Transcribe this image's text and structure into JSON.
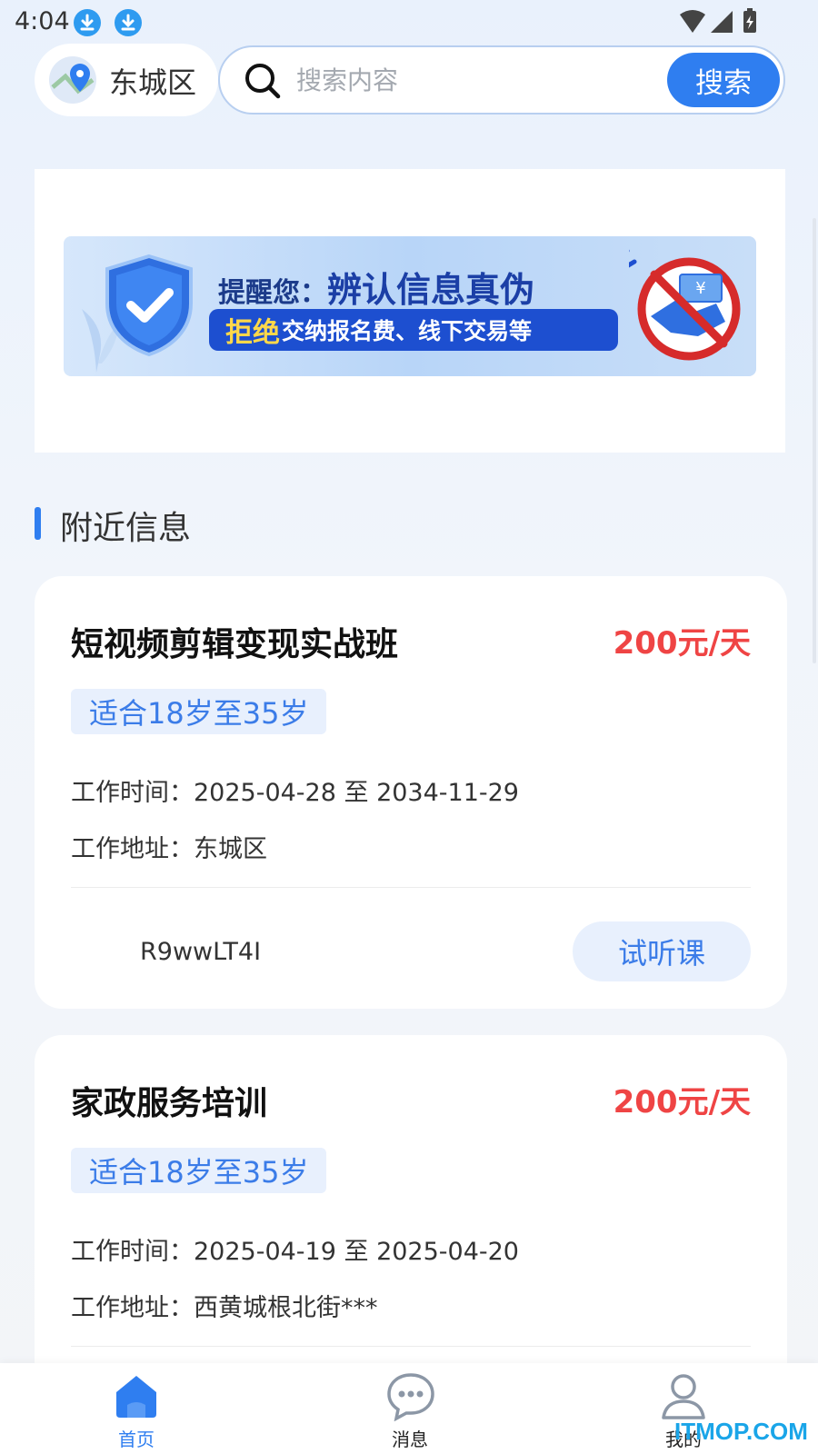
{
  "status_bar": {
    "time": "4:04"
  },
  "header": {
    "location": "东城区",
    "search_placeholder": "搜索内容",
    "search_button": "搜索"
  },
  "banner": {
    "prefix": "提醒您：",
    "headline": "辨认信息真伪",
    "highlight": "拒绝",
    "subline": "交纳报名费、线下交易等",
    "currency_symbol": "¥"
  },
  "section": {
    "title": "附近信息"
  },
  "jobs": [
    {
      "title": "短视频剪辑变现实战班",
      "pay": "200元/天",
      "tag": "适合18岁至35岁",
      "time_line": "工作时间：2025-04-28 至 2034-11-29",
      "address_line": "工作地址：东城区",
      "poster": "R9wwLT4I",
      "action": "试听课"
    },
    {
      "title": "家政服务培训",
      "pay": "200元/天",
      "tag": "适合18岁至35岁",
      "time_line": "工作时间：2025-04-19 至 2025-04-20",
      "address_line": "工作地址：西黄城根北街***"
    }
  ],
  "tabbar": {
    "items": [
      {
        "label": "首页",
        "icon": "home-icon",
        "active": true
      },
      {
        "label": "消息",
        "icon": "chat-icon",
        "active": false
      },
      {
        "label": "我的",
        "icon": "user-icon",
        "active": false
      }
    ]
  },
  "watermark": "ITMOP.COM",
  "colors": {
    "accent": "#2f7ef0",
    "price": "#ef4444",
    "tag_bg": "#e8f0fd"
  }
}
